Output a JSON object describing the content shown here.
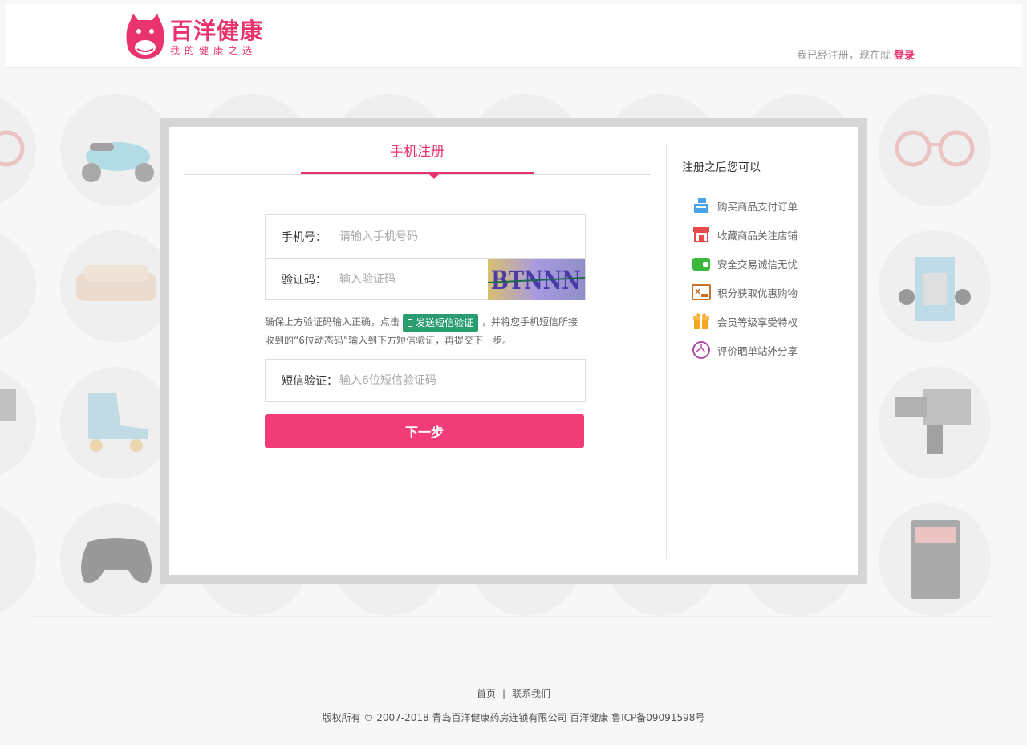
{
  "header": {
    "logo_title": "百洋健康",
    "logo_subtitle": "我的健康之选",
    "login_prompt": "我已经注册，现在就",
    "login_link": "登录"
  },
  "register": {
    "tab_label": "手机注册",
    "phone_label": "手机号：",
    "phone_placeholder": "请输入手机号码",
    "captcha_label": "验证码：",
    "captcha_placeholder": "输入验证码",
    "captcha_text": "BTNNN",
    "tip_before": "确保上方验证码输入正确，点击",
    "sms_button": "发送短信验证",
    "tip_after": "，并将您手机短信所接收到的“6位动态码”输入到下方短信验证，再提交下一步。",
    "sms_label": "短信验证：",
    "sms_placeholder": "输入6位短信验证码",
    "next_button": "下一步"
  },
  "benefits": {
    "title": "注册之后您可以",
    "items": [
      {
        "label": "购买商品支付订单",
        "icon": "cash-register-icon",
        "color": "#4aa3e8"
      },
      {
        "label": "收藏商品关注店铺",
        "icon": "shop-icon",
        "color": "#e84a4a"
      },
      {
        "label": "安全交易诚信无忧",
        "icon": "wallet-icon",
        "color": "#3cb83c"
      },
      {
        "label": "积分获取优惠购物",
        "icon": "gift-card-icon",
        "color": "#c8702c"
      },
      {
        "label": "会员等级享受特权",
        "icon": "gift-box-icon",
        "color": "#f5a623"
      },
      {
        "label": "评价晒单站外分享",
        "icon": "share-globe-icon",
        "color": "#b04aa8"
      }
    ]
  },
  "footer": {
    "home": "首页",
    "separator": "|",
    "contact": "联系我们",
    "copyright": "版权所有 © 2007-2018 青岛百洋健康药房连锁有限公司 百洋健康 鲁ICP备09091598号"
  },
  "colors": {
    "brand": "#e8336d",
    "button": "#f23c78",
    "sms_button": "#2a9d6f"
  }
}
